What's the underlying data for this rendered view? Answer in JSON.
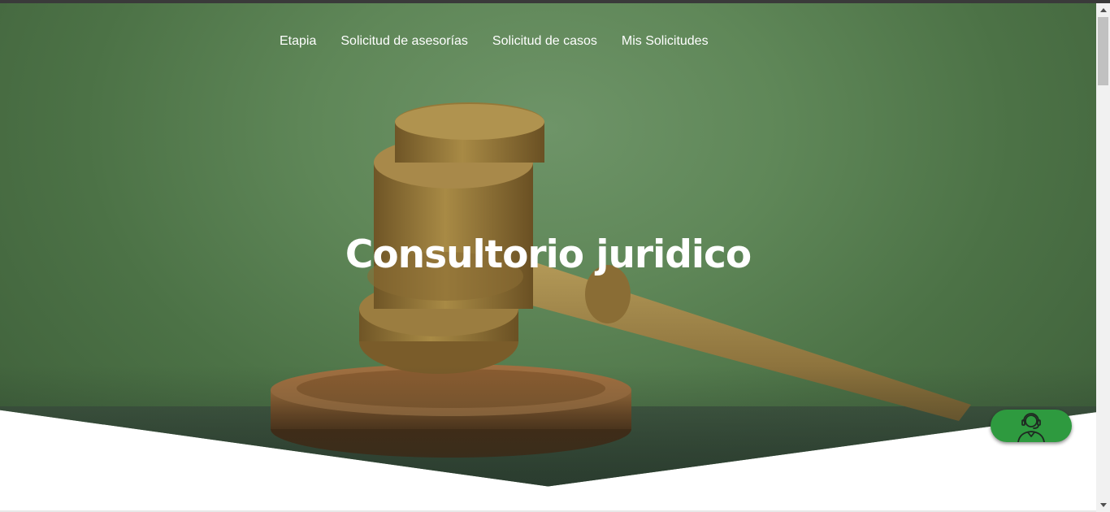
{
  "nav": {
    "items": [
      {
        "label": "Etapia"
      },
      {
        "label": "Solicitud de asesorías"
      },
      {
        "label": "Solicitud de casos"
      },
      {
        "label": "Mis Solicitudes"
      }
    ]
  },
  "hero": {
    "title": "Consultorio juridico",
    "background_image": "gavel-on-sound-block"
  },
  "help_button": {
    "icon": "customer-support-agent-icon",
    "color": "#2e9a3f"
  },
  "colors": {
    "hero_overlay": "#5f8758",
    "accent": "#2e9a3f"
  }
}
